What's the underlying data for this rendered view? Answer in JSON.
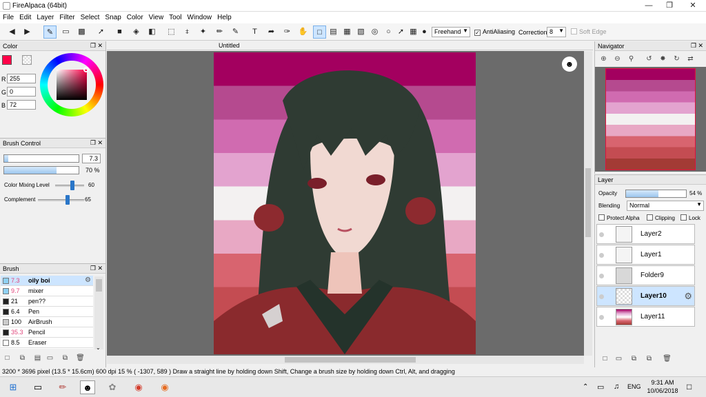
{
  "window": {
    "title": "FireAlpaca (64bit)"
  },
  "menu": [
    "File",
    "Edit",
    "Layer",
    "Filter",
    "Select",
    "Snap",
    "Color",
    "View",
    "Tool",
    "Window",
    "Help"
  ],
  "toolbar": {
    "mode_select": "Freehand",
    "antialiasing_label": "AntiAliasing",
    "correction_label": "Correction",
    "correction_value": "8",
    "soft_edge_label": "Soft Edge"
  },
  "canvas": {
    "tab_title": "Untitled"
  },
  "color_panel": {
    "title": "Color",
    "primary_color": "#FF0048",
    "r_label": "R",
    "r_value": "255",
    "g_label": "G",
    "g_value": "0",
    "b_label": "B",
    "b_value": "72"
  },
  "brush_control": {
    "title": "Brush Control",
    "size_value": "7.3",
    "size_fraction": 0.06,
    "opacity_value": "70 %",
    "opacity_fraction": 0.7,
    "mixing_label": "Color Mixing Level",
    "mixing_value": "60",
    "mixing_fraction": 0.6,
    "complement_label": "Complement",
    "complement_value": "65",
    "complement_fraction": 0.65
  },
  "brush_panel": {
    "title": "Brush",
    "items": [
      {
        "size": "7.3",
        "name": "oily boi",
        "color": "#8fd1f5",
        "size_color": "#e0457b",
        "selected": true
      },
      {
        "size": "9.7",
        "name": "mixer",
        "color": "#8fd1f5",
        "size_color": "#e0457b",
        "selected": false
      },
      {
        "size": "21",
        "name": "pen??",
        "color": "#222222",
        "size_color": "#000000",
        "selected": false
      },
      {
        "size": "6.4",
        "name": "Pen",
        "color": "#222222",
        "size_color": "#000000",
        "selected": false
      },
      {
        "size": "100",
        "name": "AirBrush",
        "color": "#cccccc",
        "size_color": "#000000",
        "selected": false
      },
      {
        "size": "35.3",
        "name": "Pencil",
        "color": "#222222",
        "size_color": "#e0457b",
        "selected": false
      },
      {
        "size": "8.5",
        "name": "Eraser",
        "color": "#ffffff",
        "size_color": "#000000",
        "selected": false
      }
    ]
  },
  "navigator": {
    "title": "Navigator"
  },
  "layer_panel": {
    "title": "Layer",
    "opacity_label": "Opacity",
    "opacity_value": "54 %",
    "opacity_fraction": 0.54,
    "blending_label": "Blending",
    "blending_value": "Normal",
    "protect_alpha_label": "Protect Alpha",
    "clipping_label": "Clipping",
    "lock_label": "Lock",
    "layers": [
      {
        "name": "Layer2",
        "selected": false,
        "bold": false
      },
      {
        "name": "Layer1",
        "selected": false,
        "bold": false
      },
      {
        "name": "Folder9",
        "selected": false,
        "bold": false
      },
      {
        "name": "Layer10",
        "selected": true,
        "bold": true
      },
      {
        "name": "Layer11",
        "selected": false,
        "bold": false
      }
    ]
  },
  "statusbar": {
    "text": "3200 * 3696 pixel   (13.5 * 15.6cm)   600 dpi   15 %   ( -1307, 589 )   Draw a straight line by holding down Shift, Change a brush size by holding down Ctrl, Alt, and dragging"
  },
  "taskbar": {
    "time": "9:31 AM",
    "date": "10/06/2018",
    "lang": "ENG"
  },
  "flag_colors": [
    "#a3005f",
    "#b54a8f",
    "#d06bb0",
    "#e3a3cf",
    "#f3f1f1",
    "#e8a8c4",
    "#d8646f",
    "#c44c52",
    "#a33b35"
  ]
}
